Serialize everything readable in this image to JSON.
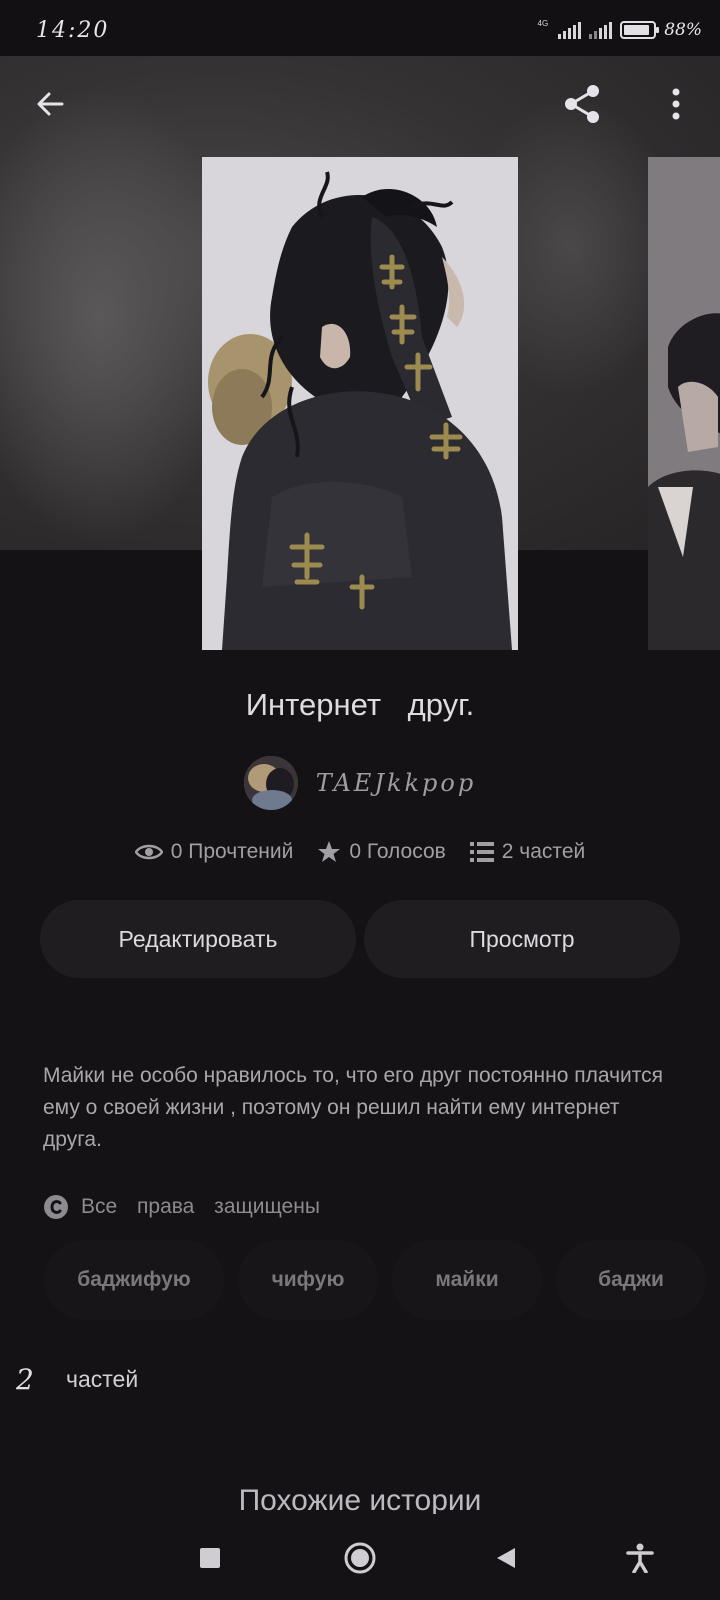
{
  "status_bar": {
    "time": "14:20",
    "network_label": "4G",
    "battery_percent": "88%",
    "battery_level": 0.88
  },
  "header": {
    "back_icon": "arrow-left-icon",
    "share_icon": "share-icon",
    "more_icon": "more-vertical-icon"
  },
  "story": {
    "title": "Интернет друг.",
    "author": "TAEJkkpop",
    "reads": "0 Прочтений",
    "votes": "0 Голосов",
    "parts_count": "2 частей",
    "description": "Майки не особо нравилось то, что его друг постоянно плачится ему о своей жизни , поэтому он решил найти ему интернет друга.",
    "rights": "Все права защищены",
    "tags": [
      "баджифую",
      "чифую",
      "майки",
      "баджи"
    ]
  },
  "actions": {
    "edit_label": "Редактировать",
    "view_label": "Просмотр"
  },
  "parts_section": {
    "number": "2",
    "label": "частей"
  },
  "similar": {
    "heading": "Похожие истории"
  },
  "colors": {
    "background": "#141215",
    "button": "#1f1d20",
    "text": "#d4d2d6"
  }
}
